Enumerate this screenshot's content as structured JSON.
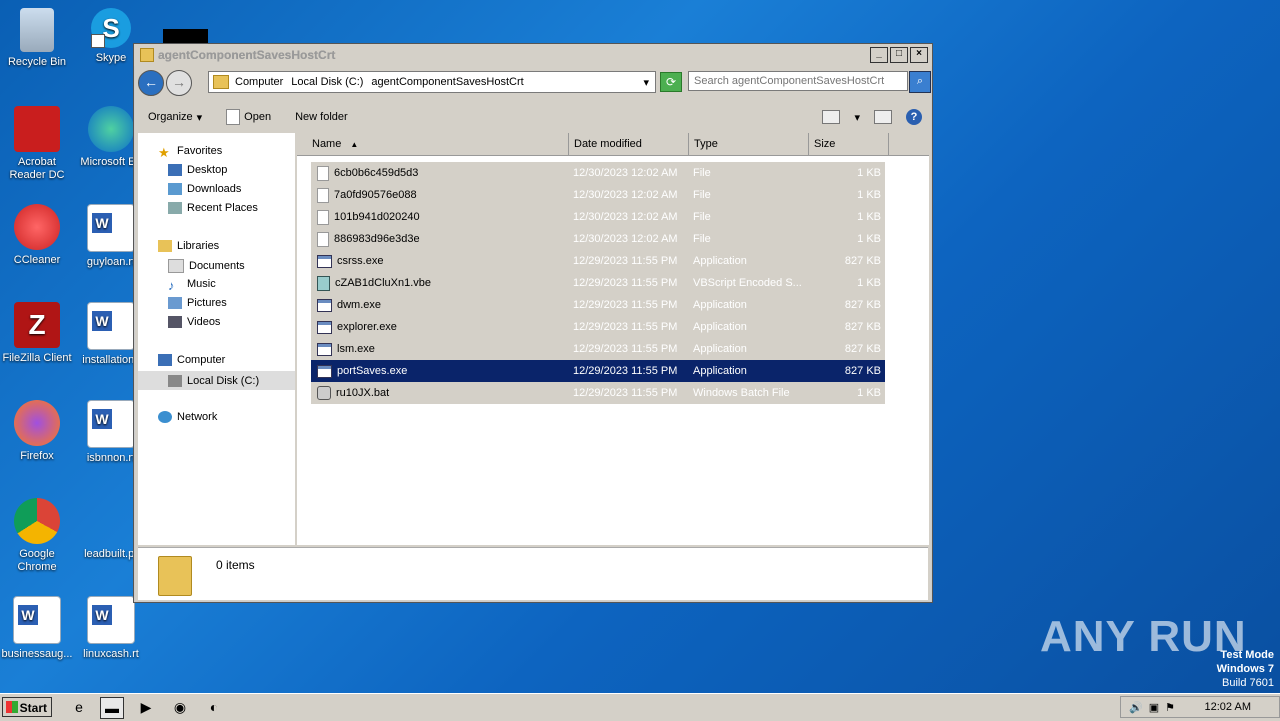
{
  "desktop": {
    "icons": [
      {
        "label": "Recycle Bin"
      },
      {
        "label": "Skype"
      },
      {
        "label": "Acrobat Reader DC"
      },
      {
        "label": "Microsoft Ed"
      },
      {
        "label": "CCleaner"
      },
      {
        "label": "guyloan.rt"
      },
      {
        "label": "FileZilla Client"
      },
      {
        "label": "installationc"
      },
      {
        "label": "Firefox"
      },
      {
        "label": "isbnnon.rt"
      },
      {
        "label": "Google Chrome"
      },
      {
        "label": "leadbuilt.pr"
      },
      {
        "label": "businessaug..."
      },
      {
        "label": "linuxcash.rt"
      }
    ],
    "watermark": "ANY RUN",
    "testmode": {
      "line1": "Test Mode",
      "line2": "Windows 7",
      "line3": "Build 7601"
    }
  },
  "window": {
    "title": "agentComponentSavesHostCrt",
    "address": {
      "crumbs": [
        "Computer",
        "Local Disk (C:)",
        "agentComponentSavesHostCrt"
      ]
    },
    "search_placeholder": "Search agentComponentSavesHostCrt",
    "toolbar": {
      "organize": "Organize",
      "open": "Open",
      "new_folder": "New folder"
    },
    "nav": {
      "favorites": "Favorites",
      "desktop": "Desktop",
      "downloads": "Downloads",
      "recent": "Recent Places",
      "libraries": "Libraries",
      "documents": "Documents",
      "music": "Music",
      "pictures": "Pictures",
      "videos": "Videos",
      "computer": "Computer",
      "local_disk": "Local Disk (C:)",
      "network": "Network"
    },
    "columns": {
      "name": "Name",
      "date": "Date modified",
      "type": "Type",
      "size": "Size"
    },
    "files": [
      {
        "name": "6cb0b6c459d5d3",
        "date": "12/30/2023 12:02 AM",
        "type": "File",
        "size": "1 KB",
        "icon": "file"
      },
      {
        "name": "7a0fd90576e088",
        "date": "12/30/2023 12:02 AM",
        "type": "File",
        "size": "1 KB",
        "icon": "file"
      },
      {
        "name": "101b941d020240",
        "date": "12/30/2023 12:02 AM",
        "type": "File",
        "size": "1 KB",
        "icon": "file"
      },
      {
        "name": "886983d96e3d3e",
        "date": "12/30/2023 12:02 AM",
        "type": "File",
        "size": "1 KB",
        "icon": "file"
      },
      {
        "name": "csrss.exe",
        "date": "12/29/2023 11:55 PM",
        "type": "Application",
        "size": "827 KB",
        "icon": "app"
      },
      {
        "name": "cZAB1dCluXn1.vbe",
        "date": "12/29/2023 11:55 PM",
        "type": "VBScript Encoded S...",
        "size": "1 KB",
        "icon": "vbe"
      },
      {
        "name": "dwm.exe",
        "date": "12/29/2023 11:55 PM",
        "type": "Application",
        "size": "827 KB",
        "icon": "app"
      },
      {
        "name": "explorer.exe",
        "date": "12/29/2023 11:55 PM",
        "type": "Application",
        "size": "827 KB",
        "icon": "app"
      },
      {
        "name": "lsm.exe",
        "date": "12/29/2023 11:55 PM",
        "type": "Application",
        "size": "827 KB",
        "icon": "app"
      },
      {
        "name": "portSaves.exe",
        "date": "12/29/2023 11:55 PM",
        "type": "Application",
        "size": "827 KB",
        "icon": "app",
        "selected": true
      },
      {
        "name": "ru10JX.bat",
        "date": "12/29/2023 11:55 PM",
        "type": "Windows Batch File",
        "size": "1 KB",
        "icon": "bat"
      }
    ],
    "status": "0 items"
  },
  "taskbar": {
    "start": "Start",
    "clock": "12:02 AM"
  }
}
